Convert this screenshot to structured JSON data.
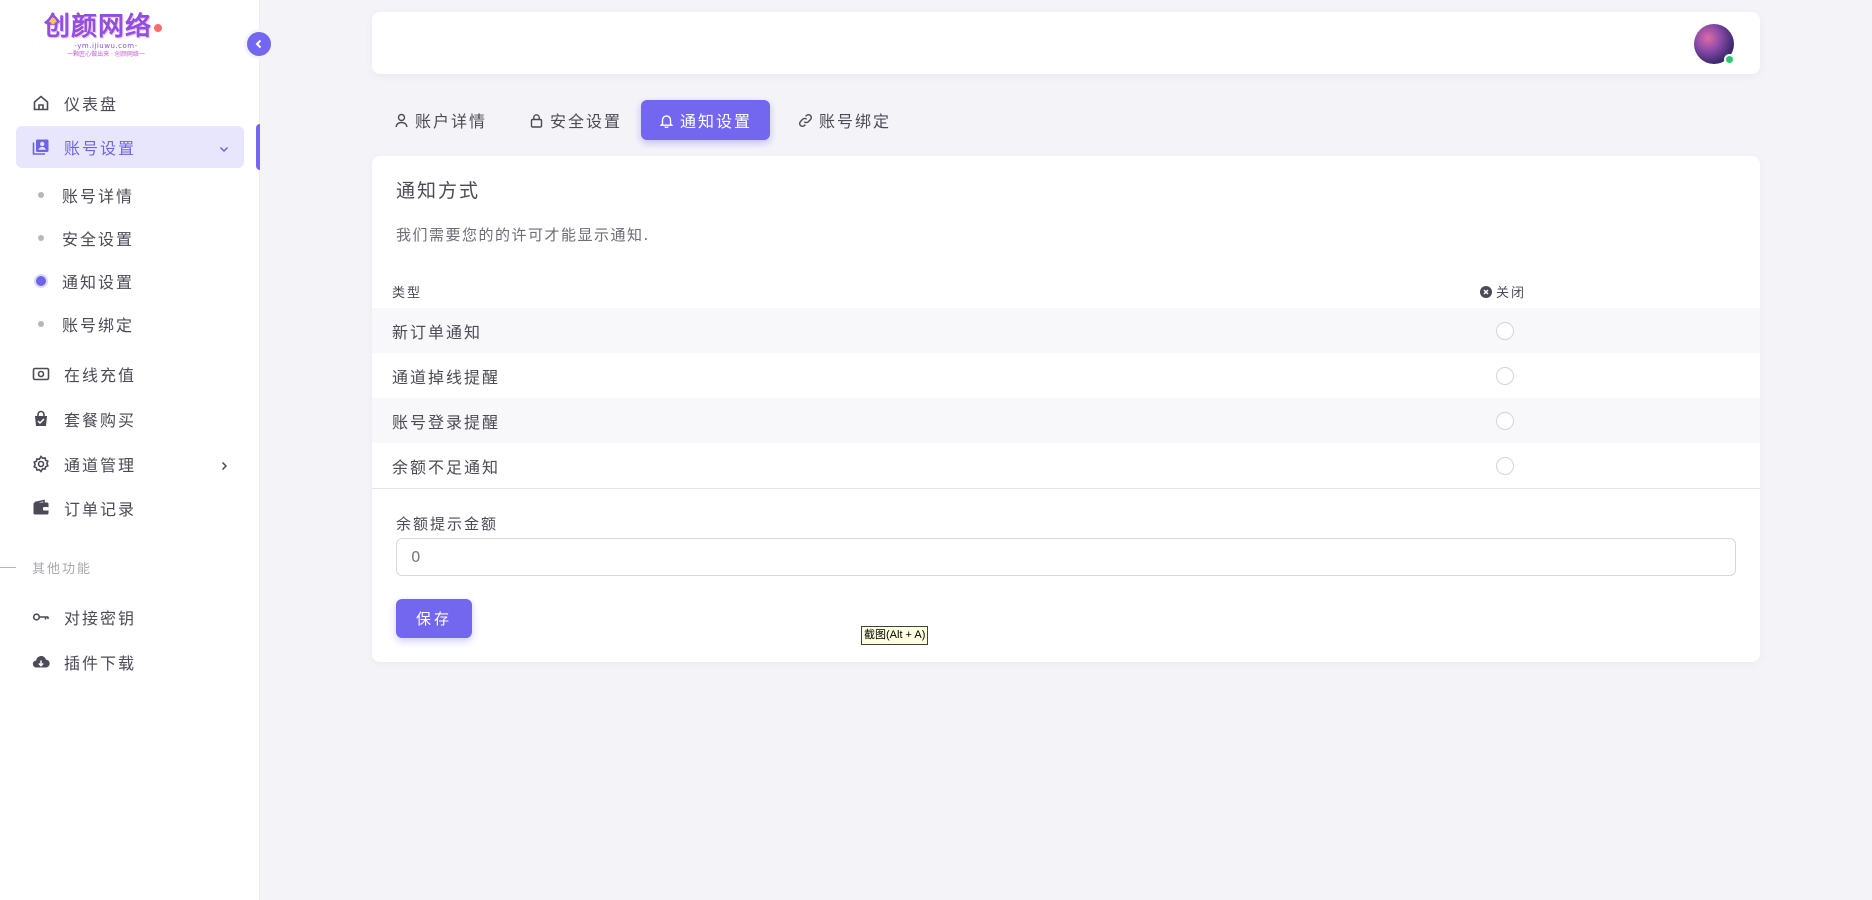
{
  "sidebar": {
    "logo": {
      "main": "创颜网络",
      "sub": "-ym.ijiuwu.com-",
      "tagline": "一颗匠心做出来 · 创颜网络一"
    },
    "items": [
      {
        "label": "仪表盘",
        "icon": "home-icon"
      },
      {
        "label": "账号设置",
        "icon": "account-settings-icon",
        "expanded": true
      },
      {
        "label": "在线充值",
        "icon": "cash-icon"
      },
      {
        "label": "套餐购买",
        "icon": "shopping-bag-icon"
      },
      {
        "label": "通道管理",
        "icon": "gear-icon"
      },
      {
        "label": "订单记录",
        "icon": "wallet-icon"
      }
    ],
    "sub_items": [
      {
        "label": "账号详情"
      },
      {
        "label": "安全设置"
      },
      {
        "label": "通知设置",
        "active": true
      },
      {
        "label": "账号绑定"
      }
    ],
    "section_label": "其他功能",
    "other_items": [
      {
        "label": "对接密钥",
        "icon": "key-icon"
      },
      {
        "label": "插件下载",
        "icon": "cloud-download-icon"
      }
    ]
  },
  "tabs": [
    {
      "label": "账户详情",
      "icon": "user-icon"
    },
    {
      "label": "安全设置",
      "icon": "lock-icon"
    },
    {
      "label": "通知设置",
      "icon": "bell-icon",
      "active": true
    },
    {
      "label": "账号绑定",
      "icon": "link-icon"
    }
  ],
  "notification": {
    "title": "通知方式",
    "subtitle": "我们需要您的的许可才能显示通知.",
    "header_type": "类型",
    "header_close": "关闭",
    "rows": [
      {
        "label": "新订单通知",
        "checked": false
      },
      {
        "label": "通道掉线提醒",
        "checked": false
      },
      {
        "label": "账号登录提醒",
        "checked": false
      },
      {
        "label": "余额不足通知",
        "checked": false
      }
    ],
    "balance_label": "余额提示金额",
    "balance_placeholder": "0",
    "save_label": "保存"
  },
  "tooltip": "截图(Alt + A)",
  "colors": {
    "accent": "#7367f0",
    "status_online": "#28c76f"
  }
}
